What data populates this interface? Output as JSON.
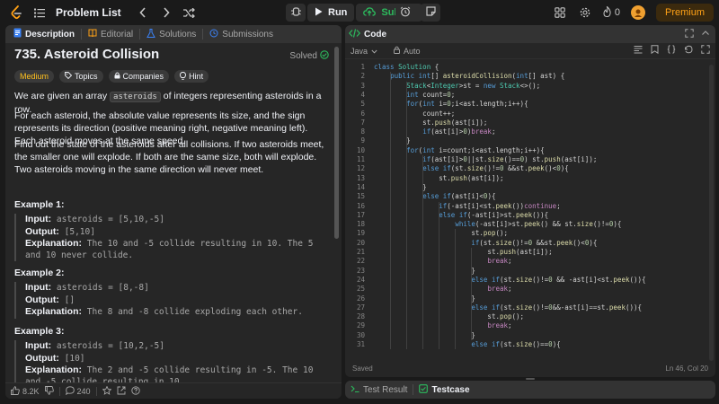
{
  "topbar": {
    "title": "Problem List",
    "run_label": "Run",
    "submit_label": "Submit",
    "streak_count": "0",
    "premium_label": "Premium"
  },
  "left_tabs": [
    {
      "label": "Description"
    },
    {
      "label": "Editorial"
    },
    {
      "label": "Solutions"
    },
    {
      "label": "Submissions"
    }
  ],
  "problem": {
    "title": "735. Asteroid Collision",
    "status": "Solved",
    "tags": [
      "Medium",
      "Topics",
      "Companies",
      "Hint"
    ],
    "para1_pre": "We are given an array",
    "para1_code": "asteroids",
    "para1_post": "of integers representing asteroids in a row.",
    "para2": "For each asteroid, the absolute value represents its size, and the sign represents its direction (positive meaning right, negative meaning left). Each asteroid moves at the same speed.",
    "para3": "Find out the state of the asteroids after all collisions. If two asteroids meet, the smaller one will explode. If both are the same size, both will explode. Two asteroids moving in the same direction will never meet.",
    "examples": [
      {
        "title": "Example 1:",
        "input_label": "Input:",
        "input": "asteroids = [5,10,-5]",
        "output_label": "Output:",
        "output": "[5,10]",
        "explanation_label": "Explanation:",
        "explanation": "The 10 and -5 collide resulting in 10. The 5 and 10 never collide."
      },
      {
        "title": "Example 2:",
        "input_label": "Input:",
        "input": "asteroids = [8,-8]",
        "output_label": "Output:",
        "output": "[]",
        "explanation_label": "Explanation:",
        "explanation": "The 8 and -8 collide exploding each other."
      },
      {
        "title": "Example 3:",
        "input_label": "Input:",
        "input": "asteroids = [10,2,-5]",
        "output_label": "Output:",
        "output": "[10]",
        "explanation_label": "Explanation:",
        "explanation": "The 2 and -5 collide resulting in -5. The 10 and -5 collide resulting in 10."
      }
    ]
  },
  "footer": {
    "likes": "8.2K",
    "comments": "240"
  },
  "code_panel": {
    "title": "Code",
    "language": "Java",
    "autocomplete": "Auto",
    "status": "Saved",
    "cursor": "Ln 46, Col 20"
  },
  "code_lines": [
    "class Solution {",
    "    public int[] asteroidCollision(int[] ast) {",
    "        Stack<Integer>st = new Stack<>();",
    "        int count=0;",
    "        for(int i=0;i<ast.length;i++){",
    "            count++;",
    "            st.push(ast[i]);",
    "            if(ast[i]>0)break;",
    "        }",
    "        for(int i=count;i<ast.length;i++){",
    "            if(ast[i]>0||st.size()==0) st.push(ast[i]);",
    "            else if(st.size()!=0 &&st.peek()<0){",
    "                st.push(ast[i]);",
    "            }",
    "            else if(ast[i]<0){",
    "                if(-ast[i]<st.peek())continue;",
    "                else if(-ast[i]>st.peek()){",
    "                    while(-ast[i]>st.peek() && st.size()!=0){",
    "                        st.pop();",
    "                        if(st.size()!=0 &&st.peek()<0){",
    "                            st.push(ast[i]);",
    "                            break;",
    "                        }",
    "                        else if(st.size()!=0 && -ast[i]<st.peek()){",
    "                            break;",
    "                        }",
    "                        else if(st.size()!=0&&-ast[i]==st.peek()){",
    "                            st.pop();",
    "                            break;",
    "                        }",
    "                        else if(st.size()==0){"
  ],
  "test_tabs": [
    {
      "label": "Test Result"
    },
    {
      "label": "Testcase"
    }
  ],
  "colors": {
    "accent_orange": "#ffa116",
    "green": "#2cbb5d",
    "medium": "#ffc01e"
  }
}
